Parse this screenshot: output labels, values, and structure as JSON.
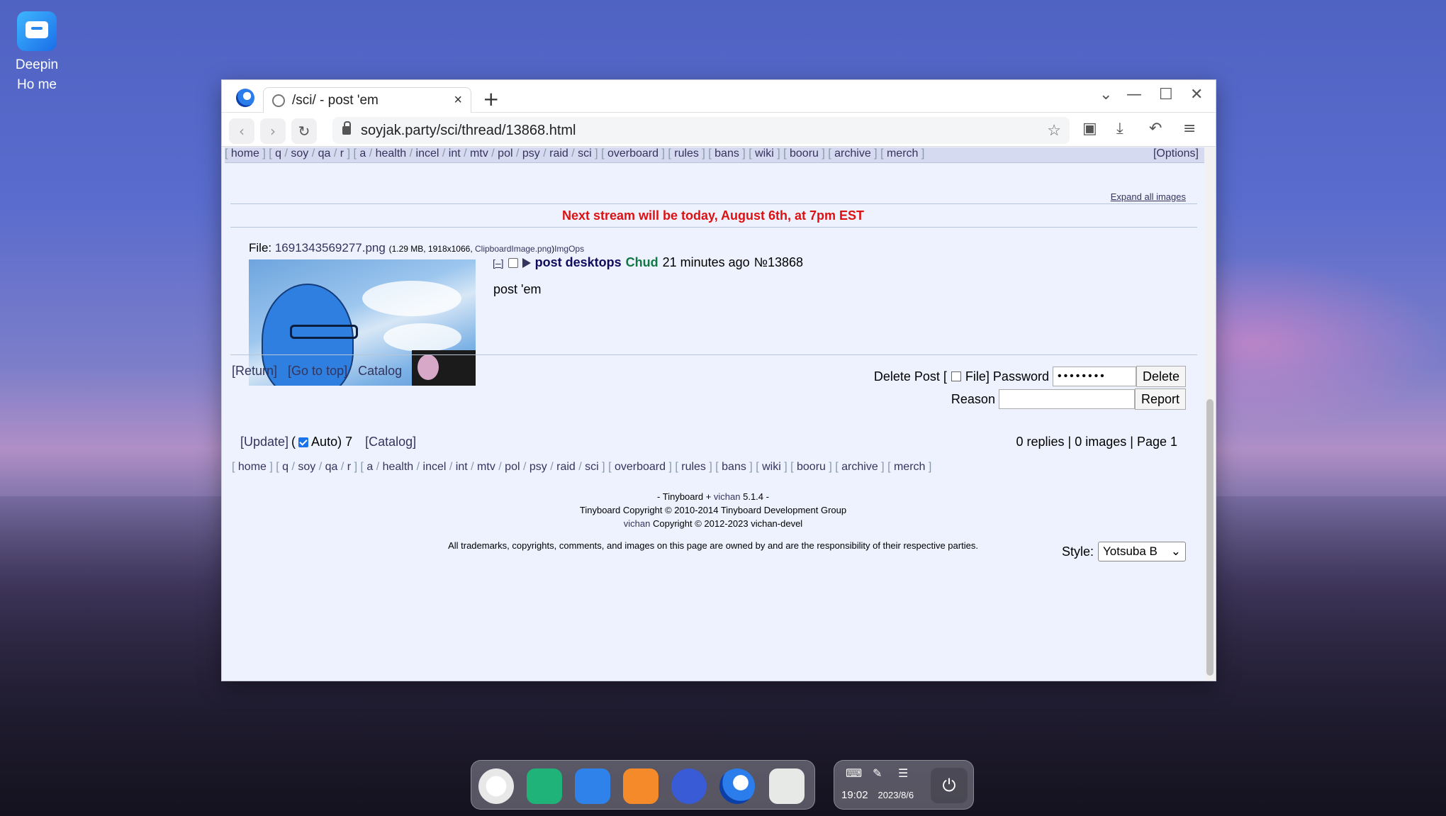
{
  "desktop": {
    "icon_label": "Deepin Ho me"
  },
  "browser": {
    "tab_title": "/sci/ - post 'em",
    "tab_close": "×",
    "new_tab": "+",
    "url": "soyjak.party/sci/thread/13868.html"
  },
  "boardlist": {
    "groups": [
      [
        "home"
      ],
      [
        "q",
        "soy",
        "qa",
        "r"
      ],
      [
        "a",
        "health",
        "incel",
        "int",
        "mtv",
        "pol",
        "psy",
        "raid",
        "sci"
      ],
      [
        "overboard"
      ],
      [
        "rules"
      ],
      [
        "bans"
      ],
      [
        "wiki"
      ],
      [
        "booru"
      ],
      [
        "archive"
      ],
      [
        "merch"
      ]
    ],
    "options_label": "[Options]"
  },
  "page": {
    "expand_all": "Expand all images",
    "announcement": "Next stream will be today, August 6th, at 7pm EST",
    "file_label": "File: ",
    "file_name": "1691343569277.png",
    "file_meta": "(1.29 MB, 1918x1066, ",
    "file_orig": "ClipboardImage.png",
    "file_meta_end": ")",
    "imgops": "ImgOps",
    "hide": "[–]",
    "subject": "post desktops",
    "name": "Chud",
    "time": "21 minutes ago",
    "post_no": "№13868",
    "body": "post 'em",
    "return_link": "[Return]",
    "top_link": "[Go to top]",
    "catalog_link": "Catalog",
    "delete_post_label": "Delete Post [",
    "file_label2": "File]",
    "password_label": "Password",
    "password_value": "••••••••",
    "delete_button": "Delete",
    "reason_label": "Reason",
    "report_button": "Report",
    "update_link": "[Update]",
    "auto_open": "(",
    "auto_label": "Auto) 7",
    "catalog_link2": "[Catalog]",
    "stats": "0 replies | 0 images | Page 1",
    "footer_line1_pre": "- Tinyboard + ",
    "footer_vichan": "vichan",
    "footer_line1_post": " 5.1.4 -",
    "footer_line2": "Tinyboard Copyright © 2010-2014 Tinyboard Development Group",
    "footer_line3_post": " Copyright © 2012-2023 vichan-devel",
    "footer_tm": "All trademarks, copyrights, comments, and images on this page are owned by and are the responsibility of their respective parties.",
    "style_label": "Style:",
    "style_value": "Yotsuba B"
  },
  "tray": {
    "time": "19:02",
    "date": "2023/8/6"
  },
  "colors": {
    "link": "#34345c",
    "announce": "#dd1111",
    "name": "#117743",
    "subject": "#0f0c5d",
    "page_bg": "#eef2ff"
  }
}
